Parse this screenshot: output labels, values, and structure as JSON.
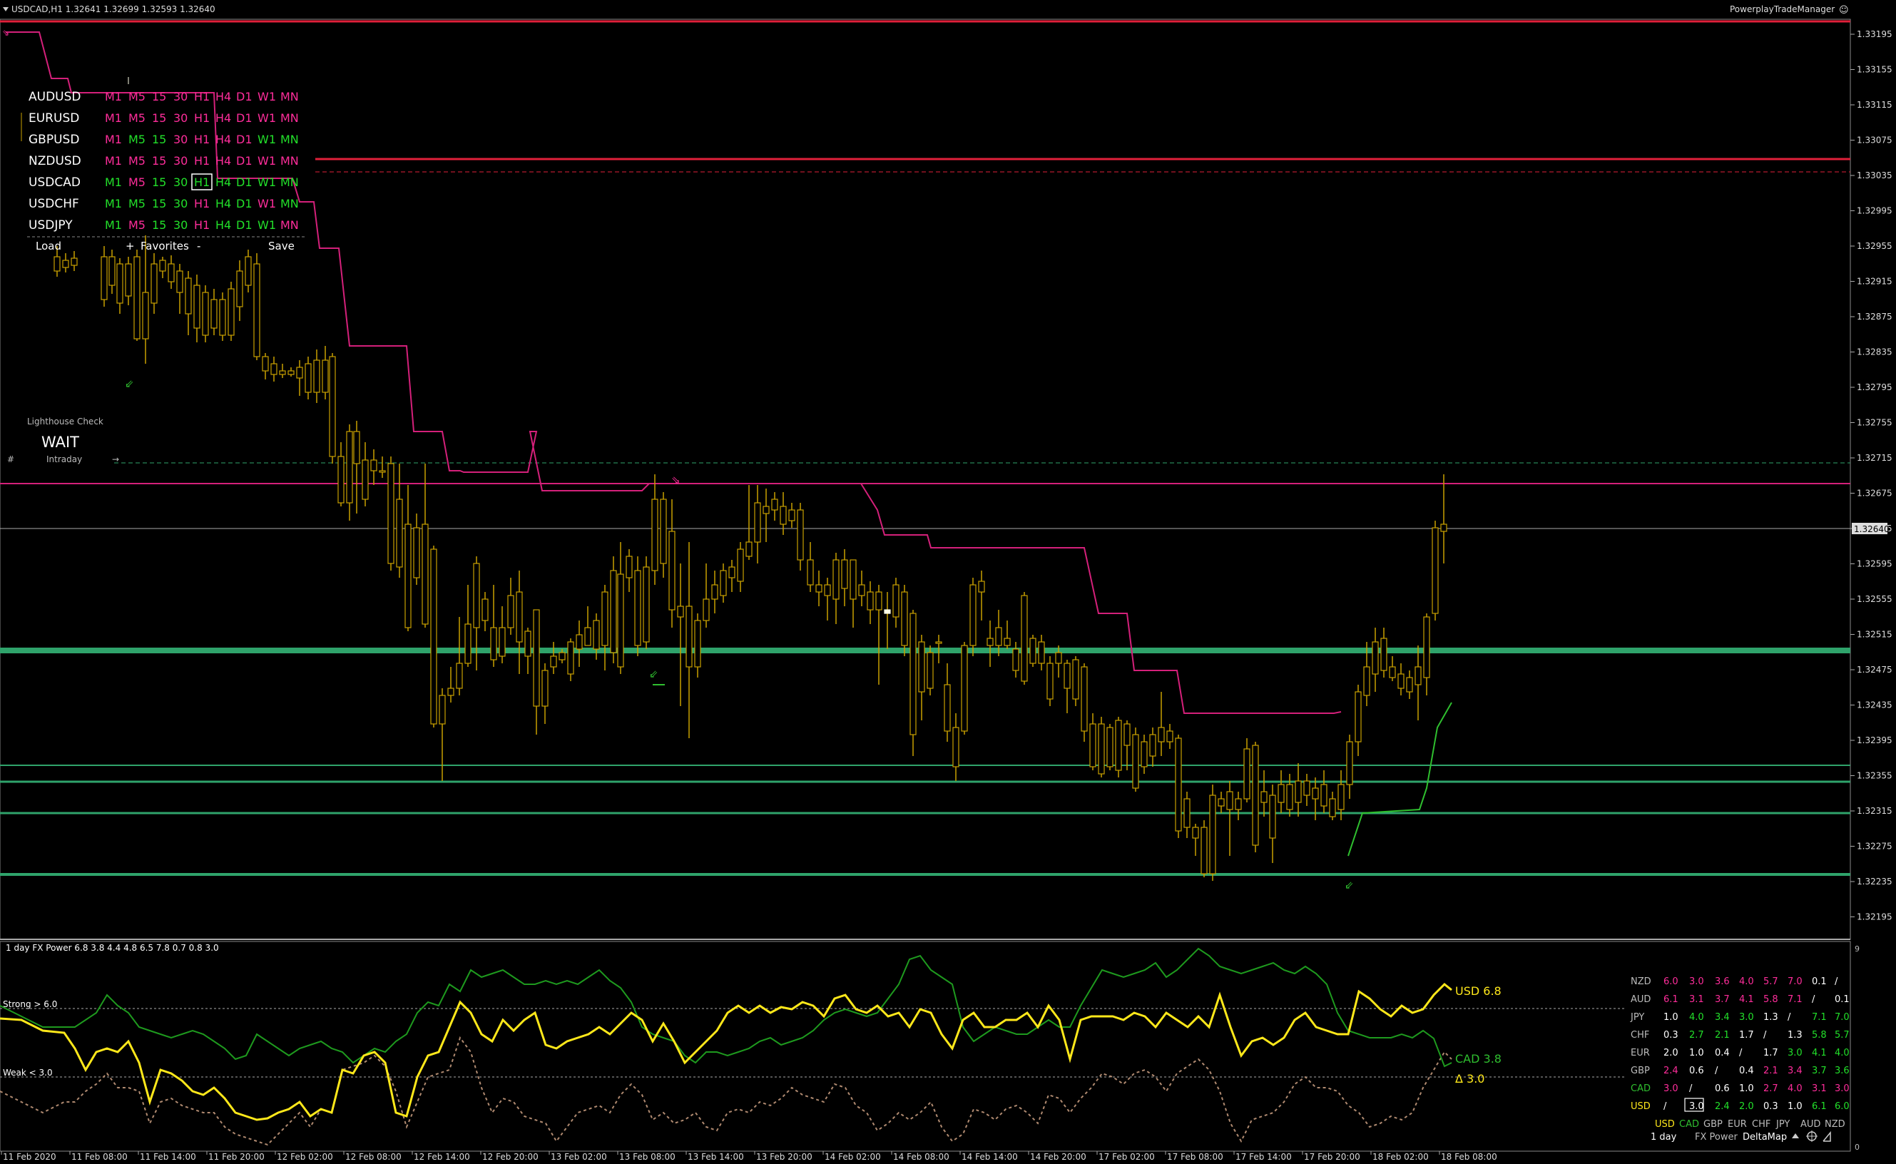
{
  "header": {
    "symbol_info": "USDCAD,H1  1.32641 1.32699 1.32593 1.32640",
    "tool_name": "PowerplayTradeManager",
    "smiley": "☺"
  },
  "price_axis": {
    "labels": [
      "1.33195",
      "1.33155",
      "1.33115",
      "1.33075",
      "1.33035",
      "1.32995",
      "1.32955",
      "1.32915",
      "1.32875",
      "1.32835",
      "1.32795",
      "1.32755",
      "1.32715",
      "1.32675",
      "1.32635",
      "1.32595",
      "1.32555",
      "1.32515",
      "1.32475",
      "1.32435",
      "1.32395",
      "1.32355",
      "1.32315",
      "1.32275",
      "1.32235",
      "1.32195"
    ],
    "current_price": "1.32640"
  },
  "time_axis": {
    "labels": [
      "11 Feb 2020",
      "11 Feb 08:00",
      "11 Feb 14:00",
      "11 Feb 20:00",
      "12 Feb 02:00",
      "12 Feb 08:00",
      "12 Feb 14:00",
      "12 Feb 20:00",
      "13 Feb 02:00",
      "13 Feb 08:00",
      "13 Feb 14:00",
      "13 Feb 20:00",
      "14 Feb 02:00",
      "14 Feb 08:00",
      "14 Feb 14:00",
      "14 Feb 20:00",
      "17 Feb 02:00",
      "17 Feb 08:00",
      "17 Feb 14:00",
      "17 Feb 20:00",
      "18 Feb 02:00",
      "18 Feb 08:00"
    ]
  },
  "symbol_panel": {
    "rows": [
      {
        "symbol": "AUDUSD",
        "tfs": [
          "M1",
          "M5",
          "15",
          "30",
          "H1",
          "H4",
          "D1",
          "W1",
          "MN"
        ],
        "colors": [
          "#ff2d9b",
          "#ff2d9b",
          "#ff2d9b",
          "#ff2d9b",
          "#ff2d9b",
          "#ff2d9b",
          "#ff2d9b",
          "#ff2d9b",
          "#ff2d9b"
        ]
      },
      {
        "symbol": "EURUSD",
        "tfs": [
          "M1",
          "M5",
          "15",
          "30",
          "H1",
          "H4",
          "D1",
          "W1",
          "MN"
        ],
        "colors": [
          "#ff2d9b",
          "#ff2d9b",
          "#ff2d9b",
          "#ff2d9b",
          "#ff2d9b",
          "#ff2d9b",
          "#ff2d9b",
          "#ff2d9b",
          "#ff2d9b"
        ]
      },
      {
        "symbol": "GBPUSD",
        "tfs": [
          "M1",
          "M5",
          "15",
          "30",
          "H1",
          "H4",
          "D1",
          "W1",
          "MN"
        ],
        "colors": [
          "#ff2d9b",
          "#22e02a",
          "#22e02a",
          "#ff2d9b",
          "#ff2d9b",
          "#ff2d9b",
          "#ff2d9b",
          "#22e02a",
          "#22e02a"
        ]
      },
      {
        "symbol": "NZDUSD",
        "tfs": [
          "M1",
          "M5",
          "15",
          "30",
          "H1",
          "H4",
          "D1",
          "W1",
          "MN"
        ],
        "colors": [
          "#ff2d9b",
          "#ff2d9b",
          "#ff2d9b",
          "#ff2d9b",
          "#ff2d9b",
          "#ff2d9b",
          "#ff2d9b",
          "#ff2d9b",
          "#ff2d9b"
        ]
      },
      {
        "symbol": "USDCAD",
        "tfs": [
          "M1",
          "M5",
          "15",
          "30",
          "H1",
          "H4",
          "D1",
          "W1",
          "MN"
        ],
        "colors": [
          "#22e02a",
          "#ff2d9b",
          "#22e02a",
          "#22e02a",
          "#22e02a",
          "#22e02a",
          "#22e02a",
          "#22e02a",
          "#22e02a"
        ]
      },
      {
        "symbol": "USDCHF",
        "tfs": [
          "M1",
          "M5",
          "15",
          "30",
          "H1",
          "H4",
          "D1",
          "W1",
          "MN"
        ],
        "colors": [
          "#22e02a",
          "#22e02a",
          "#22e02a",
          "#22e02a",
          "#ff2d9b",
          "#22e02a",
          "#22e02a",
          "#ff2d9b",
          "#22e02a"
        ]
      },
      {
        "symbol": "USDJPY",
        "tfs": [
          "M1",
          "M5",
          "15",
          "30",
          "H1",
          "H4",
          "D1",
          "W1",
          "MN"
        ],
        "colors": [
          "#22e02a",
          "#ff2d9b",
          "#22e02a",
          "#22e02a",
          "#ff2d9b",
          "#22e02a",
          "#22e02a",
          "#22e02a",
          "#ff2d9b"
        ]
      }
    ],
    "selected_symbol": "USDCAD",
    "selected_tf": "H1",
    "load_label": "Load",
    "plus_label": "+",
    "favorites_label": "Favorites",
    "minus_label": "-",
    "save_label": "Save"
  },
  "lighthouse": {
    "title": "Lighthouse Check",
    "status": "WAIT",
    "mode": "Intraday",
    "left_mark": "#",
    "right_mark": "→"
  },
  "indicator": {
    "title": "1 day FX Power 6.8 3.8 4.4 4.8 6.5 7.8 0.7 0.8 3.0",
    "strong_label": "Strong > 6.0",
    "weak_label": "Weak < 3.0",
    "scale_top": "9",
    "scale_bottom": "0",
    "usd_label": "USD 6.8",
    "cad_label": "CAD 3.8",
    "delta_label": "Δ 3.0"
  },
  "matrix": {
    "row_heads": [
      "NZD",
      "AUD",
      "JPY",
      "CHF",
      "EUR",
      "GBP",
      "CAD",
      "USD"
    ],
    "cells": [
      [
        {
          "t": "6.0",
          "c": "#ff2d9b"
        },
        {
          "t": "3.0",
          "c": "#ff2d9b"
        },
        {
          "t": "3.6",
          "c": "#ff2d9b"
        },
        {
          "t": "4.0",
          "c": "#ff2d9b"
        },
        {
          "t": "5.7",
          "c": "#ff2d9b"
        },
        {
          "t": "7.0",
          "c": "#ff2d9b"
        },
        {
          "t": "0.1",
          "c": "#ffffff"
        },
        {
          "t": "/",
          "c": "#ffffff"
        }
      ],
      [
        {
          "t": "6.1",
          "c": "#ff2d9b"
        },
        {
          "t": "3.1",
          "c": "#ff2d9b"
        },
        {
          "t": "3.7",
          "c": "#ff2d9b"
        },
        {
          "t": "4.1",
          "c": "#ff2d9b"
        },
        {
          "t": "5.8",
          "c": "#ff2d9b"
        },
        {
          "t": "7.1",
          "c": "#ff2d9b"
        },
        {
          "t": "/",
          "c": "#ffffff"
        },
        {
          "t": "0.1",
          "c": "#ffffff"
        }
      ],
      [
        {
          "t": "1.0",
          "c": "#ffffff"
        },
        {
          "t": "4.0",
          "c": "#22e02a"
        },
        {
          "t": "3.4",
          "c": "#22e02a"
        },
        {
          "t": "3.0",
          "c": "#22e02a"
        },
        {
          "t": "1.3",
          "c": "#ffffff"
        },
        {
          "t": "/",
          "c": "#ffffff"
        },
        {
          "t": "7.1",
          "c": "#22e02a"
        },
        {
          "t": "7.0",
          "c": "#22e02a"
        }
      ],
      [
        {
          "t": "0.3",
          "c": "#ffffff"
        },
        {
          "t": "2.7",
          "c": "#22e02a"
        },
        {
          "t": "2.1",
          "c": "#22e02a"
        },
        {
          "t": "1.7",
          "c": "#ffffff"
        },
        {
          "t": "/",
          "c": "#ffffff"
        },
        {
          "t": "1.3",
          "c": "#ffffff"
        },
        {
          "t": "5.8",
          "c": "#22e02a"
        },
        {
          "t": "5.7",
          "c": "#22e02a"
        }
      ],
      [
        {
          "t": "2.0",
          "c": "#ffffff"
        },
        {
          "t": "1.0",
          "c": "#ffffff"
        },
        {
          "t": "0.4",
          "c": "#ffffff"
        },
        {
          "t": "/",
          "c": "#ffffff"
        },
        {
          "t": "1.7",
          "c": "#ffffff"
        },
        {
          "t": "3.0",
          "c": "#22e02a"
        },
        {
          "t": "4.1",
          "c": "#22e02a"
        },
        {
          "t": "4.0",
          "c": "#22e02a"
        }
      ],
      [
        {
          "t": "2.4",
          "c": "#ff2d9b"
        },
        {
          "t": "0.6",
          "c": "#ffffff"
        },
        {
          "t": "/",
          "c": "#ffffff"
        },
        {
          "t": "0.4",
          "c": "#ffffff"
        },
        {
          "t": "2.1",
          "c": "#ff2d9b"
        },
        {
          "t": "3.4",
          "c": "#ff2d9b"
        },
        {
          "t": "3.7",
          "c": "#22e02a"
        },
        {
          "t": "3.6",
          "c": "#22e02a"
        }
      ],
      [
        {
          "t": "3.0",
          "c": "#ff2d9b"
        },
        {
          "t": "/",
          "c": "#ffffff"
        },
        {
          "t": "0.6",
          "c": "#ffffff"
        },
        {
          "t": "1.0",
          "c": "#ffffff"
        },
        {
          "t": "2.7",
          "c": "#ff2d9b"
        },
        {
          "t": "4.0",
          "c": "#ff2d9b"
        },
        {
          "t": "3.1",
          "c": "#ff2d9b"
        },
        {
          "t": "3.0",
          "c": "#ff2d9b"
        }
      ],
      [
        {
          "t": "/",
          "c": "#ffffff"
        },
        {
          "t": "3.0",
          "c": "#ffffff"
        },
        {
          "t": "2.4",
          "c": "#22e02a"
        },
        {
          "t": "2.0",
          "c": "#22e02a"
        },
        {
          "t": "0.3",
          "c": "#ffffff"
        },
        {
          "t": "1.0",
          "c": "#ffffff"
        },
        {
          "t": "6.1",
          "c": "#22e02a"
        },
        {
          "t": "6.0",
          "c": "#22e02a"
        }
      ]
    ],
    "col_heads": [
      "USD",
      "CAD",
      "GBP",
      "EUR",
      "CHF",
      "JPY",
      "AUD",
      "NZD"
    ],
    "footer_period": "1 day",
    "footer_fxpower": "FX Power",
    "footer_deltamap": "DeltaMap"
  },
  "colors": {
    "bull": "#ffffe8",
    "bear": "#c8a000",
    "wick": "#c8a000",
    "support": "#2fa36b",
    "resistance": "#e0203a",
    "trail_magenta": "#d4207a",
    "trail_green": "#2fbf2f",
    "usd_line": "#ffe81a",
    "cad_line": "#1e9a1e",
    "delta_line": "#b08a70"
  }
}
